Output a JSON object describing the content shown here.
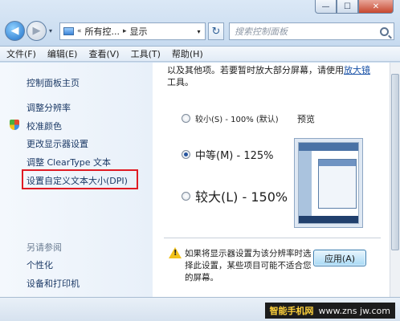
{
  "window": {
    "min_glyph": "—",
    "max_glyph": "☐",
    "close_glyph": "✕"
  },
  "address": {
    "prefix": "«",
    "segment1": "所有控...",
    "sep": "▸",
    "segment2": "显示",
    "dropdown": "▾"
  },
  "search": {
    "placeholder": "搜索控制面板"
  },
  "nav": {
    "back_glyph": "◀",
    "forward_glyph": "▶",
    "dropdown": "▾",
    "refresh_glyph": "↻"
  },
  "menu": [
    "文件(F)",
    "编辑(E)",
    "查看(V)",
    "工具(T)",
    "帮助(H)"
  ],
  "sidebar": {
    "home": "控制面板主页",
    "items": [
      "调整分辨率",
      "校准颜色",
      "更改显示器设置",
      "调整 ClearType 文本",
      "设置自定义文本大小(DPI)"
    ],
    "see_also_heading": "另请参阅",
    "see_also": [
      "个性化",
      "设备和打印机"
    ]
  },
  "main": {
    "desc_text": "以及其他项。若要暂时放大部分屏幕，请使用",
    "desc_link": "放大镜",
    "desc_tail": "工具。",
    "preview_label": "预览",
    "options": [
      "较小(S) - 100% (默认)",
      "中等(M) - 125%",
      "较大(L) - 150%"
    ],
    "selected_index": 1,
    "warning": "如果将显示器设置为该分辨率时选择此设置，某些项目可能不适合您的屏幕。",
    "warning_glyph": "!",
    "apply_label": "应用(A)"
  },
  "watermark": {
    "brand": "智能手机网",
    "url": "www.zns jw.com"
  }
}
